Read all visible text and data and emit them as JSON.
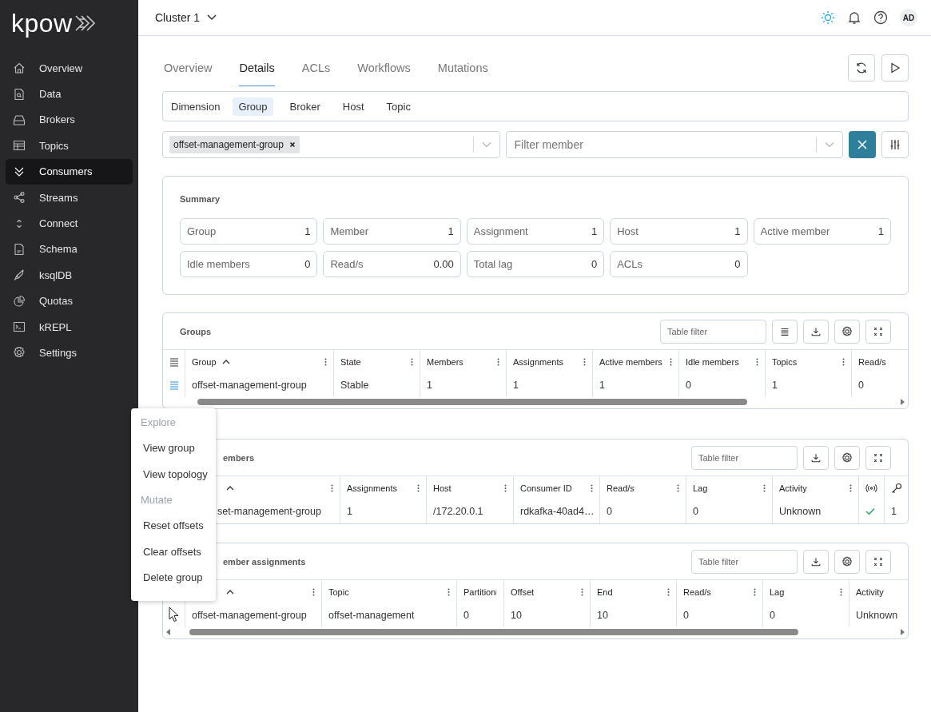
{
  "logo": "kpow",
  "sidebar": {
    "items": [
      {
        "label": "Overview",
        "selected": false
      },
      {
        "label": "Data",
        "selected": false
      },
      {
        "label": "Brokers",
        "selected": false
      },
      {
        "label": "Topics",
        "selected": false
      },
      {
        "label": "Consumers",
        "selected": true
      },
      {
        "label": "Streams",
        "selected": false
      },
      {
        "label": "Connect",
        "selected": false
      },
      {
        "label": "Schema",
        "selected": false
      },
      {
        "label": "ksqlDB",
        "selected": false
      },
      {
        "label": "Quotas",
        "selected": false
      },
      {
        "label": "kREPL",
        "selected": false
      },
      {
        "label": "Settings",
        "selected": false
      }
    ]
  },
  "header": {
    "cluster": "Cluster 1",
    "avatar": "AD"
  },
  "tabs": [
    {
      "label": "Overview",
      "selected": false
    },
    {
      "label": "Details",
      "selected": true
    },
    {
      "label": "ACLs",
      "selected": false
    },
    {
      "label": "Workflows",
      "selected": false
    },
    {
      "label": "Mutations",
      "selected": false
    }
  ],
  "dimension": {
    "label": "Dimension",
    "options": [
      {
        "label": "Group",
        "selected": true
      },
      {
        "label": "Broker",
        "selected": false
      },
      {
        "label": "Host",
        "selected": false
      },
      {
        "label": "Topic",
        "selected": false
      }
    ]
  },
  "group_filter": {
    "chips": [
      "offset-management-group"
    ]
  },
  "member_filter": {
    "placeholder": "Filter member"
  },
  "summary": {
    "title": "Summary",
    "stats": [
      {
        "label": "Group",
        "value": "1"
      },
      {
        "label": "Member",
        "value": "1"
      },
      {
        "label": "Assignment",
        "value": "1"
      },
      {
        "label": "Host",
        "value": "1"
      },
      {
        "label": "Active member",
        "value": "1"
      },
      {
        "label": "Idle members",
        "value": "0"
      },
      {
        "label": "Read/s",
        "value": "0.00"
      },
      {
        "label": "Total lag",
        "value": "0"
      },
      {
        "label": "ACLs",
        "value": "0"
      }
    ]
  },
  "tables": [
    {
      "title": "Groups",
      "filter_placeholder": "Table filter",
      "tools": [
        {
          "kind": "columns"
        },
        {
          "kind": "download"
        },
        {
          "kind": "settings"
        },
        {
          "kind": "expand"
        }
      ],
      "row_icons": true,
      "columns": [
        {
          "label": "Group",
          "sorted": true
        },
        {
          "label": "State"
        },
        {
          "label": "Members"
        },
        {
          "label": "Assignments"
        },
        {
          "label": "Active members"
        },
        {
          "label": "Idle members"
        },
        {
          "label": "Topics"
        },
        {
          "label": "Read/s"
        }
      ],
      "rows": [
        [
          "offset-management-group",
          "Stable",
          "1",
          "1",
          "1",
          "0",
          "1",
          "0"
        ]
      ]
    },
    {
      "title": "embers",
      "filter_placeholder": "Table filter",
      "tools": [
        {
          "kind": "download"
        },
        {
          "kind": "settings"
        },
        {
          "kind": "expand"
        }
      ],
      "columns": [
        {
          "sorted": true
        },
        {
          "label": "Assignments"
        },
        {
          "label": "Host"
        },
        {
          "label": "Consumer ID"
        },
        {
          "label": "Read/s"
        },
        {
          "label": "Lag"
        },
        {
          "label": "Activity"
        },
        {
          "kind": "signal"
        },
        {
          "kind": "key"
        }
      ],
      "rows": [
        [
          "set-management-group",
          "1",
          "/172.20.0.1",
          "rdkafka-40ad4…",
          "0",
          "0",
          "Unknown",
          {
            "checked": true
          },
          "1"
        ]
      ]
    },
    {
      "title": "ember assignments",
      "filter_placeholder": "Table filter",
      "tools": [
        {
          "kind": "download"
        },
        {
          "kind": "settings"
        },
        {
          "kind": "expand"
        }
      ],
      "scroll_arrows": true,
      "columns": [
        {
          "sorted": true
        },
        {
          "label": "Topic"
        },
        {
          "label": "Partition"
        },
        {
          "label": "Offset"
        },
        {
          "label": "End"
        },
        {
          "label": "Read/s"
        },
        {
          "label": "Lag"
        },
        {
          "label": "Activity"
        }
      ],
      "rows": [
        [
          "offset-management-group",
          "offset-management",
          "0",
          "10",
          "10",
          "0",
          "0",
          "Unknown"
        ]
      ]
    }
  ],
  "context_menu": {
    "sections": [
      {
        "heading": "Explore",
        "items": [
          "View group",
          "View topology"
        ]
      },
      {
        "heading": "Mutate",
        "items": [
          "Reset offsets",
          "Clear offsets",
          "Delete group"
        ]
      }
    ]
  }
}
